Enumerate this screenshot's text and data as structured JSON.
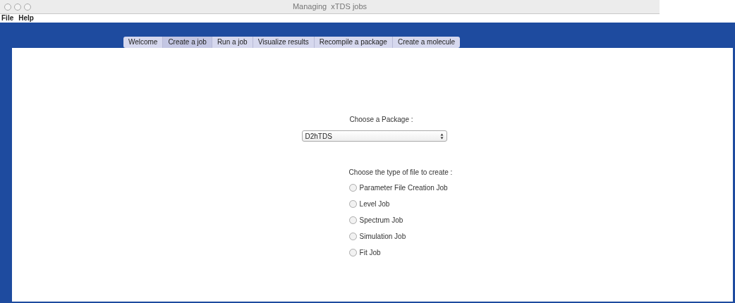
{
  "window": {
    "title": "Managing  xTDS jobs"
  },
  "menu": [
    "File",
    "Help"
  ],
  "tabs": [
    {
      "label": "Welcome",
      "selected": false
    },
    {
      "label": "Create a job",
      "selected": true
    },
    {
      "label": "Run a job",
      "selected": false
    },
    {
      "label": "Visualize results",
      "selected": false
    },
    {
      "label": "Recompile a package",
      "selected": false
    },
    {
      "label": "Create a molecule",
      "selected": false
    }
  ],
  "package": {
    "label": "Choose a Package :",
    "value": "D2hTDS"
  },
  "file_type": {
    "label": "Choose the type of file to create :",
    "options": [
      {
        "label": "Parameter File Creation Job",
        "selected": false
      },
      {
        "label": "Level Job",
        "selected": false
      },
      {
        "label": "Spectrum Job",
        "selected": false
      },
      {
        "label": "Simulation Job",
        "selected": false
      },
      {
        "label": "Fit Job",
        "selected": false
      }
    ]
  }
}
